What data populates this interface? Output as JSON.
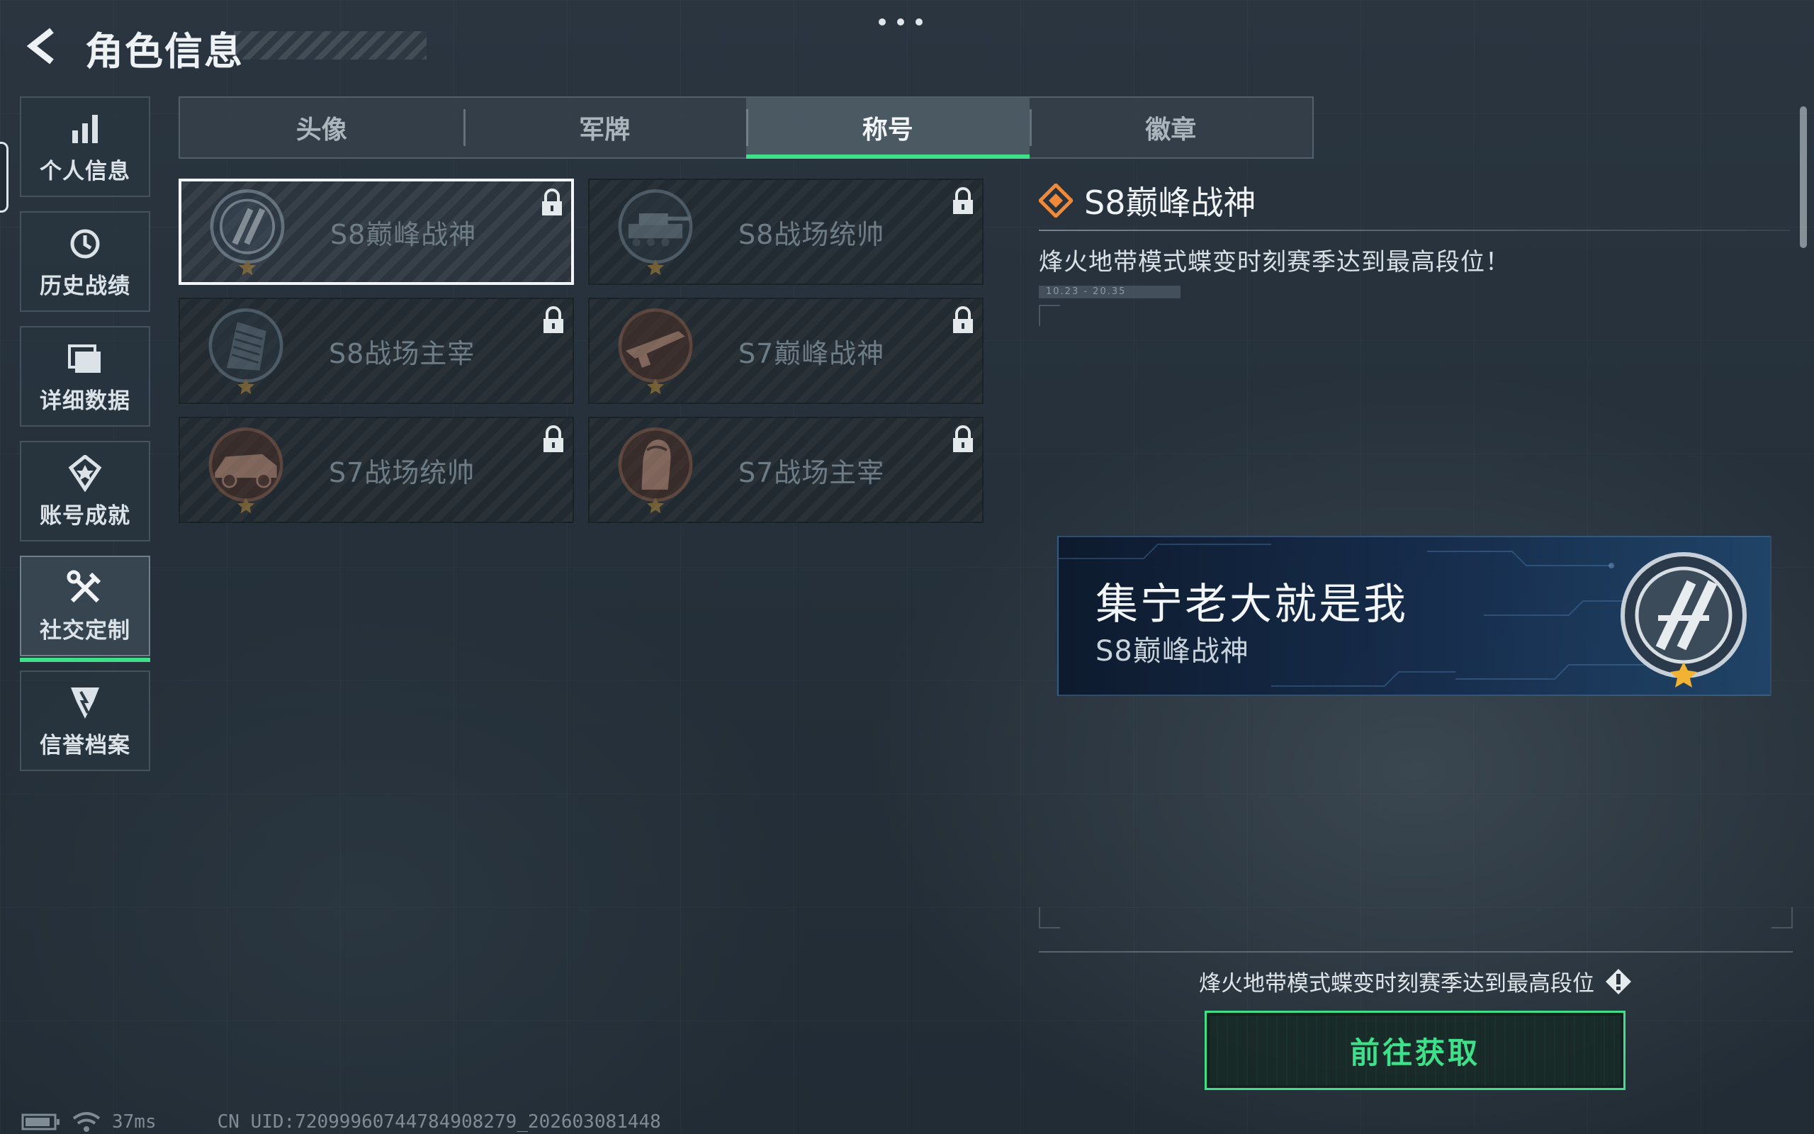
{
  "header": {
    "title": "角色信息",
    "back_icon": "back-arrow-icon",
    "more_icon": "more-dots-icon"
  },
  "sidebar": {
    "items": [
      {
        "label": "个人信息",
        "icon": "bar-chart-icon",
        "active": false
      },
      {
        "label": "历史战绩",
        "icon": "clock-icon",
        "active": false
      },
      {
        "label": "详细数据",
        "icon": "folder-icon",
        "active": false
      },
      {
        "label": "账号成就",
        "icon": "achievement-icon",
        "active": false
      },
      {
        "label": "社交定制",
        "icon": "tools-icon",
        "active": true
      },
      {
        "label": "信誉档案",
        "icon": "shield-icon",
        "active": false
      }
    ]
  },
  "tabs": [
    {
      "label": "头像",
      "active": false
    },
    {
      "label": "军牌",
      "active": false
    },
    {
      "label": "称号",
      "active": true
    },
    {
      "label": "徽章",
      "active": false
    }
  ],
  "titles": [
    {
      "name": "S8巅峰战神",
      "badge": "wreath-emblem-icon",
      "locked": true,
      "selected": true
    },
    {
      "name": "S8战场统帅",
      "badge": "tank-emblem-icon",
      "locked": true,
      "selected": false
    },
    {
      "name": "S8战场主宰",
      "badge": "building-emblem-icon",
      "locked": true,
      "selected": false
    },
    {
      "name": "S7巅峰战神",
      "badge": "rifle-emblem-icon",
      "locked": true,
      "selected": false
    },
    {
      "name": "S7战场统帅",
      "badge": "vehicle-emblem-icon",
      "locked": true,
      "selected": false
    },
    {
      "name": "S7战场主宰",
      "badge": "soldier-emblem-icon",
      "locked": true,
      "selected": false
    }
  ],
  "detail": {
    "title": "S8巅峰战神",
    "icon": "diamond-rank-icon",
    "description": "烽火地带模式蝶变时刻赛季达到最高段位！",
    "date": "10.23 - 20.35"
  },
  "preview": {
    "player_name": "集宁老大就是我",
    "title": "S8巅峰战神"
  },
  "requirement": {
    "text": "烽火地带模式蝶变时刻赛季达到最高段位",
    "icon": "info-diamond-icon"
  },
  "action": {
    "label": "前往获取"
  },
  "status": {
    "ping": "37ms",
    "uid": "CN UID:720999607447849082​79_202603081448"
  },
  "colors": {
    "accent": "#3ee08a",
    "rank_orange": "#f08a3a"
  }
}
